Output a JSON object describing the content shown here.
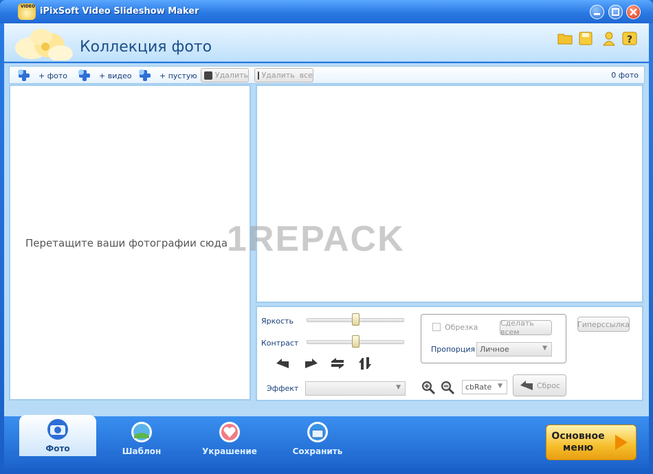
{
  "window": {
    "title": "iPixSoft Video Slideshow Maker",
    "logo_text": "VIDEO"
  },
  "header": {
    "title": "Коллекция фото"
  },
  "toolbar": {
    "add_photo": "+ фото",
    "add_video": "+ видео",
    "add_blank": "+ пустую",
    "delete": "Удалить",
    "delete_all": "Удалить  все",
    "photo_count": "0 фото"
  },
  "photo_list": {
    "drop_hint": "Перетащите ваши фотографии сюда"
  },
  "edit": {
    "brightness_label": "Яркость",
    "brightness_level": 0.5,
    "contrast_label": "Контраст",
    "contrast_level": 0.5,
    "effect_label": "Эффект",
    "effect_value": "",
    "crop_label": "Обрезка",
    "apply_all": "Сделать всем",
    "ratio_label": "Пропорция",
    "ratio_value": "Личное",
    "hyperlink": "Гиперссылка",
    "rate_value": "cbRate",
    "reset": "Сброс"
  },
  "watermark": "1REPACK",
  "bottom_nav": {
    "tabs": [
      {
        "label": "Фото"
      },
      {
        "label": "Шаблон"
      },
      {
        "label": "Украшение"
      },
      {
        "label": "Сохранить"
      }
    ],
    "main_menu": "Основное\nменю"
  },
  "colors": {
    "accent": "#1f6fd0",
    "panel_border": "#9fcbee",
    "main_menu": "#f6bf2c"
  }
}
